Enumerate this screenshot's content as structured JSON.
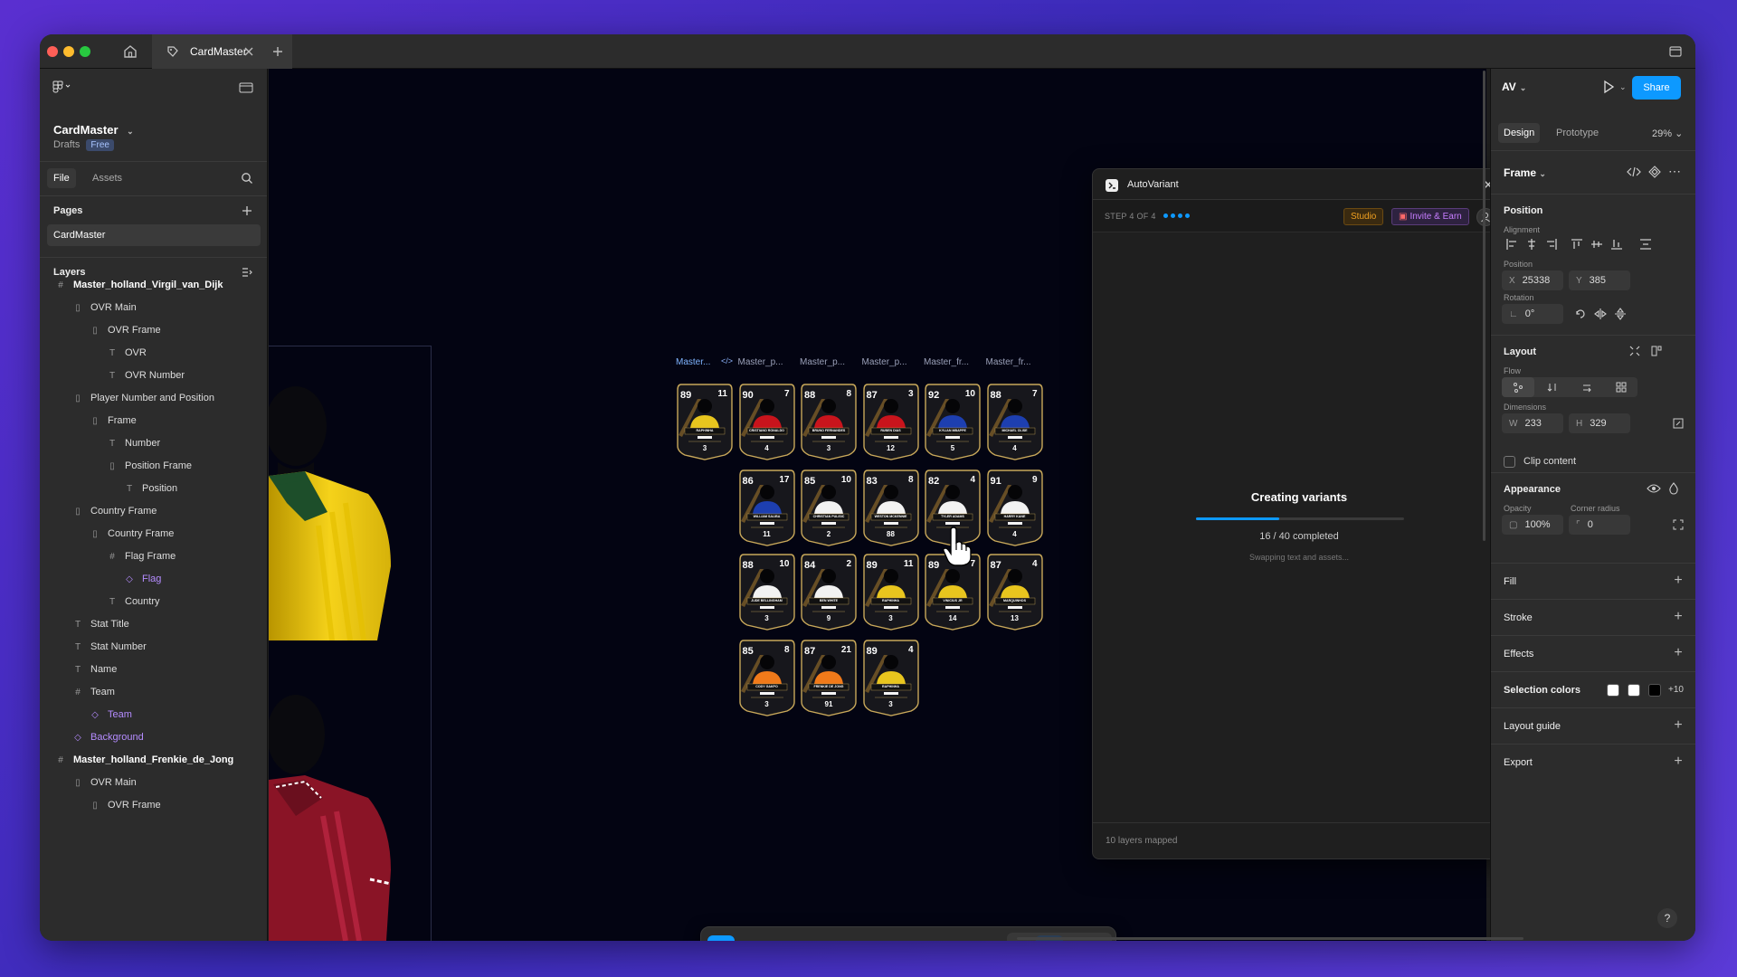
{
  "window": {
    "tab_title": "CardMaster"
  },
  "left_panel": {
    "file_name": "CardMaster",
    "drafts_label": "Drafts",
    "plan_badge": "Free",
    "tabs": [
      "File",
      "Assets"
    ],
    "pages_heading": "Pages",
    "pages": [
      "CardMaster"
    ],
    "layers_heading": "Layers",
    "layers": [
      {
        "name": "Master_holland_Virgil_van_Dijk",
        "depth": 0,
        "icon": "frame-icon",
        "bold": true
      },
      {
        "name": "OVR Main",
        "depth": 1,
        "icon": "autolayout-icon"
      },
      {
        "name": "OVR Frame",
        "depth": 2,
        "icon": "autolayout-icon"
      },
      {
        "name": "OVR",
        "depth": 3,
        "icon": "text-icon"
      },
      {
        "name": "OVR Number",
        "depth": 3,
        "icon": "text-icon"
      },
      {
        "name": "Player Number and Position",
        "depth": 1,
        "icon": "autolayout-icon"
      },
      {
        "name": "Frame",
        "depth": 2,
        "icon": "autolayout-icon"
      },
      {
        "name": "Number",
        "depth": 3,
        "icon": "text-icon"
      },
      {
        "name": "Position Frame",
        "depth": 3,
        "icon": "autolayout-icon"
      },
      {
        "name": "Position",
        "depth": 4,
        "icon": "text-icon"
      },
      {
        "name": "Country Frame",
        "depth": 1,
        "icon": "autolayout-icon"
      },
      {
        "name": "Country Frame",
        "depth": 2,
        "icon": "autolayout-icon"
      },
      {
        "name": "Flag Frame",
        "depth": 3,
        "icon": "frame-icon"
      },
      {
        "name": "Flag",
        "depth": 4,
        "icon": "component-icon",
        "purple": true
      },
      {
        "name": "Country",
        "depth": 3,
        "icon": "text-icon"
      },
      {
        "name": "Stat Title",
        "depth": 1,
        "icon": "text-icon"
      },
      {
        "name": "Stat Number",
        "depth": 1,
        "icon": "text-icon"
      },
      {
        "name": "Name",
        "depth": 1,
        "icon": "text-icon"
      },
      {
        "name": "Team",
        "depth": 1,
        "icon": "frame-icon"
      },
      {
        "name": "Team",
        "depth": 2,
        "icon": "component-icon",
        "purple": true
      },
      {
        "name": "Background",
        "depth": 1,
        "icon": "component-icon",
        "purple": true
      },
      {
        "name": "Master_holland_Frenkie_de_Jong",
        "depth": 0,
        "icon": "frame-icon",
        "bold": true
      },
      {
        "name": "OVR Main",
        "depth": 1,
        "icon": "autolayout-icon"
      },
      {
        "name": "OVR Frame",
        "depth": 2,
        "icon": "autolayout-icon"
      }
    ]
  },
  "canvas": {
    "frame_labels": [
      "Master...",
      "Master_p...",
      "Master_p...",
      "Master_p...",
      "Master_fr...",
      "Master_fr..."
    ],
    "cards": [
      {
        "ovr": "89",
        "num": "11",
        "name": "RAPHINHA",
        "stat": "3",
        "kit": "#e8c51e"
      },
      {
        "ovr": "90",
        "num": "7",
        "name": "CRISTIANO RONALDO",
        "stat": "4",
        "kit": "#c9141c"
      },
      {
        "ovr": "88",
        "num": "8",
        "name": "BRUNO FERNANDES",
        "stat": "3",
        "kit": "#c9141c"
      },
      {
        "ovr": "87",
        "num": "3",
        "name": "RUBEN DIAS",
        "stat": "12",
        "kit": "#c9141c"
      },
      {
        "ovr": "92",
        "num": "10",
        "name": "KYLIAN MBAPPE",
        "stat": "5",
        "kit": "#1d3fb0"
      },
      {
        "ovr": "88",
        "num": "7",
        "name": "MICHAEL OLISE",
        "stat": "4",
        "kit": "#1d3fb0"
      },
      {
        "ovr": "86",
        "num": "17",
        "name": "WILLIAM SALIBA",
        "stat": "11",
        "kit": "#1d3fb0"
      },
      {
        "ovr": "85",
        "num": "10",
        "name": "CHRISTIAN PULISIC",
        "stat": "2",
        "kit": "#f2f2f2"
      },
      {
        "ovr": "83",
        "num": "8",
        "name": "WESTON MCKENNIE",
        "stat": "88",
        "kit": "#f2f2f2"
      },
      {
        "ovr": "82",
        "num": "4",
        "name": "TYLER ADAMS",
        "stat": "0",
        "kit": "#f2f2f2"
      },
      {
        "ovr": "91",
        "num": "9",
        "name": "HARRY KANE",
        "stat": "4",
        "kit": "#f2f2f2"
      },
      {
        "ovr": "88",
        "num": "10",
        "name": "JUDE BELLINGHAM",
        "stat": "3",
        "kit": "#f2f2f2"
      },
      {
        "ovr": "84",
        "num": "2",
        "name": "BEN WHITE",
        "stat": "9",
        "kit": "#f2f2f2"
      },
      {
        "ovr": "89",
        "num": "11",
        "name": "RAPHINHA",
        "stat": "3",
        "kit": "#e8c51e"
      },
      {
        "ovr": "89",
        "num": "7",
        "name": "VINICIUS JR",
        "stat": "14",
        "kit": "#e8c51e"
      },
      {
        "ovr": "87",
        "num": "4",
        "name": "MARQUINHOS",
        "stat": "13",
        "kit": "#e8c51e"
      },
      {
        "ovr": "85",
        "num": "8",
        "name": "CODY GAKPO",
        "stat": "3",
        "kit": "#f07a1a"
      },
      {
        "ovr": "87",
        "num": "21",
        "name": "FRENKIE DE JONG",
        "stat": "91",
        "kit": "#f07a1a"
      },
      {
        "ovr": "89",
        "num": "4",
        "name": "RAPHINHA",
        "stat": "3",
        "kit": "#e8c51e"
      }
    ]
  },
  "plugin": {
    "title": "AutoVariant",
    "step_label": "STEP 4 OF 4",
    "studio_button": "Studio",
    "invite_button": "Invite & Earn",
    "progress_title": "Creating variants",
    "progress_count": "16 / 40 completed",
    "progress_fraction": 0.4,
    "progress_detail": "Swapping text and assets...",
    "footer": "10 layers mapped"
  },
  "right_panel": {
    "avatar_initials": "AV",
    "share_button": "Share",
    "tabs": [
      "Design",
      "Prototype"
    ],
    "zoom": "29%",
    "selection_type": "Frame",
    "position_heading": "Position",
    "alignment_label": "Alignment",
    "position_label": "Position",
    "x_label": "X",
    "x_value": "25338",
    "y_label": "Y",
    "y_value": "385",
    "rotation_label": "Rotation",
    "rotation_value": "0°",
    "layout_heading": "Layout",
    "flow_label": "Flow",
    "dimensions_label": "Dimensions",
    "w_label": "W",
    "w_value": "233",
    "h_label": "H",
    "h_value": "329",
    "clip_content": "Clip content",
    "appearance_heading": "Appearance",
    "opacity_label": "Opacity",
    "opacity_value": "100%",
    "corner_radius_label": "Corner radius",
    "corner_radius_value": "0",
    "fill": "Fill",
    "stroke": "Stroke",
    "effects": "Effects",
    "selection_colors": "Selection colors",
    "selection_colors_more": "+10",
    "layout_guide": "Layout guide",
    "export": "Export"
  },
  "colors": {
    "accent": "#0d99ff",
    "purple": "#b58cff",
    "studio": "#f0a020",
    "invite": "#c77dff"
  }
}
